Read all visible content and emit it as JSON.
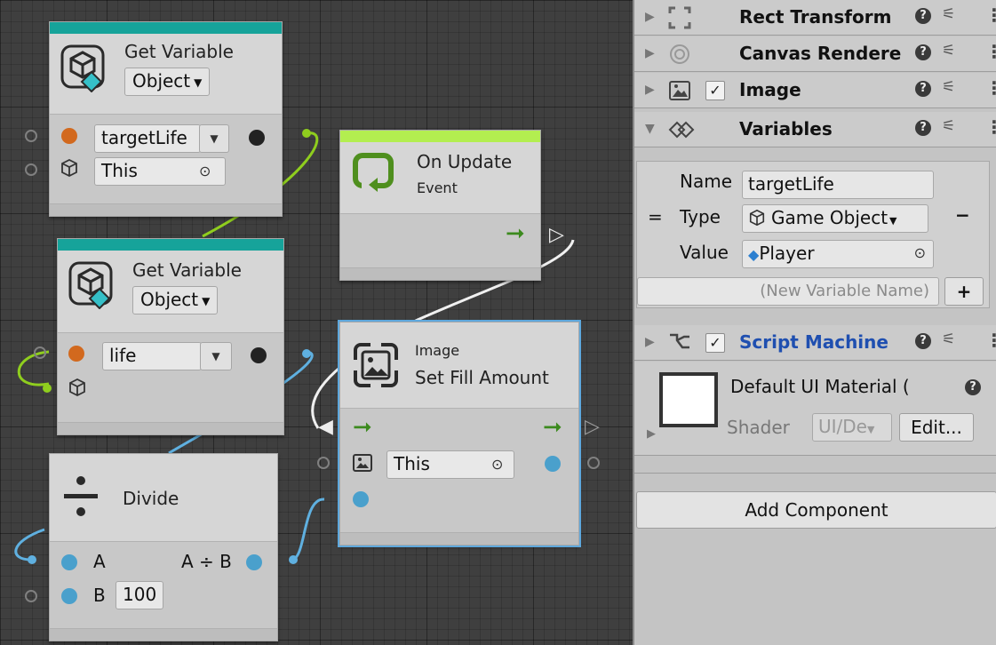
{
  "graph": {
    "get_variable_1": {
      "title": "Get Variable",
      "kind_dropdown": "Object",
      "name_field": "targetLife",
      "target_field": "This"
    },
    "get_variable_2": {
      "title": "Get Variable",
      "kind_dropdown": "Object",
      "name_field": "life"
    },
    "on_update": {
      "title": "On Update",
      "subtitle": "Event"
    },
    "set_fill": {
      "category": "Image",
      "title": "Set Fill Amount",
      "target_field": "This"
    },
    "divide": {
      "title": "Divide",
      "input_a": "A",
      "input_b": "B",
      "input_b_value": "100",
      "output": "A ÷ B"
    },
    "colors": {
      "get_variable_stripe": "#16a39a",
      "event_stripe": "#b3ee50",
      "control_arrow": "#3c8a1e",
      "object_port": "#d2691e",
      "number_port": "#4aa0cc",
      "object_wire": "#8fce1e",
      "number_wire": "#5fb0e0",
      "control_wire": "#f0f0f0"
    }
  },
  "inspector": {
    "components": [
      {
        "name": "Rect Transform",
        "icon": "rect-transform-icon"
      },
      {
        "name": "Canvas Rendere",
        "icon": "canvas-renderer-icon"
      },
      {
        "name": "Image",
        "icon": "image-icon"
      },
      {
        "name": "Variables",
        "icon": "variables-icon"
      }
    ],
    "variables": {
      "name_label": "Name",
      "name_value": "targetLife",
      "type_label": "Type",
      "type_value": "Game Object",
      "value_label": "Value",
      "value_value": "Player",
      "new_variable_placeholder": "(New Variable Name)",
      "add_button": "+",
      "remove_button": "−"
    },
    "script_machine": {
      "name": "Script Machine",
      "icon": "script-machine-icon"
    },
    "material": {
      "name": "Default UI Material (",
      "shader_label": "Shader",
      "shader_value": "UI/De",
      "edit_button": "Edit..."
    },
    "add_component_button": "Add Component",
    "accent": "#1f4fb0"
  }
}
